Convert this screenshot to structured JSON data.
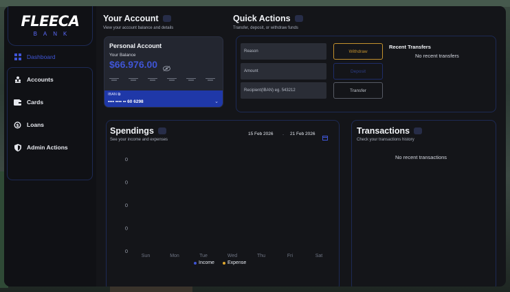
{
  "brand": {
    "logo": "FLEECA",
    "sub": "BANK",
    "accent": "#3f55d6"
  },
  "sidebar": {
    "items": [
      {
        "label": "Dashboard",
        "icon": "grid-icon",
        "active": true
      },
      {
        "label": "Accounts",
        "icon": "users-icon",
        "active": false
      },
      {
        "label": "Cards",
        "icon": "wallet-icon",
        "active": false
      },
      {
        "label": "Loans",
        "icon": "loan-icon",
        "active": false
      },
      {
        "label": "Admin Actions",
        "icon": "shield-icon",
        "active": false
      }
    ]
  },
  "your_account": {
    "title": "Your Account",
    "subtitle": "View your account balance and details",
    "card": {
      "name": "Personal Account",
      "balance_label": "Your Balance",
      "balance": "$66.976.00",
      "iban_label": "IBAN",
      "iban": "•••• •••• •• 60 6298"
    }
  },
  "quick_actions": {
    "title": "Quick Actions",
    "subtitle": "Transfer, deposit, or withdraw funds",
    "reason_placeholder": "Reason",
    "amount_placeholder": "Amount",
    "recipient_placeholder": "Recipient(IBAN) eg. 543212",
    "withdraw": "Withdraw",
    "deposit": "Deposit",
    "transfer": "Transfer",
    "recent_title": "Recent Transfers",
    "recent_empty": "No recent transfers"
  },
  "spendings": {
    "title": "Spendings",
    "subtitle": "See your income and expenses",
    "date_from": "15 Feb 2026",
    "date_sep": "-",
    "date_to": "21 Feb 2026"
  },
  "transactions": {
    "title": "Transactions",
    "subtitle": "Check your transactions history",
    "empty": "No recent transactions"
  },
  "chart_data": {
    "type": "bar",
    "categories": [
      "Sun",
      "Mon",
      "Tue",
      "Wed",
      "Thu",
      "Fri",
      "Sat"
    ],
    "y_ticks": [
      "0",
      "0",
      "0",
      "0",
      "0"
    ],
    "series": [
      {
        "name": "Income",
        "color": "#3f55d6",
        "values": [
          0,
          0,
          0,
          0,
          0,
          0,
          0
        ]
      },
      {
        "name": "Expense",
        "color": "#e0a82e",
        "values": [
          0,
          0,
          0,
          0,
          0,
          0,
          0
        ]
      }
    ],
    "grid": false,
    "legend": "bottom"
  }
}
